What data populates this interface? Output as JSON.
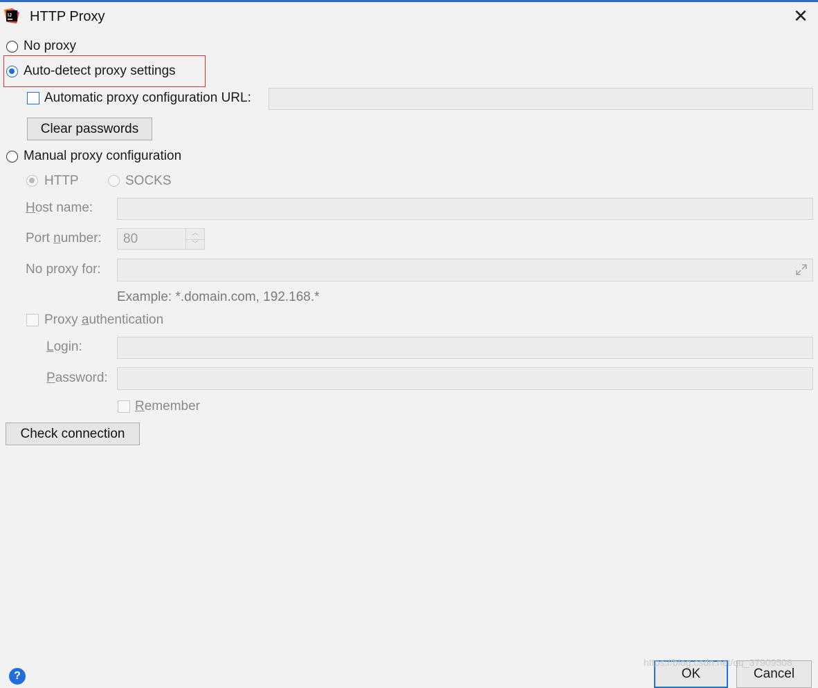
{
  "window": {
    "title": "HTTP Proxy",
    "app_icon": "intellij-idea-icon",
    "close_icon": "close-icon"
  },
  "modes": {
    "no_proxy": "No proxy",
    "auto_detect": "Auto-detect proxy settings",
    "manual": "Manual proxy configuration",
    "selected": "auto_detect"
  },
  "auto": {
    "pac_label": "Automatic proxy configuration URL:",
    "pac_checked": false,
    "pac_value": "",
    "clear_passwords": "Clear passwords"
  },
  "manual": {
    "http_label": "HTTP",
    "socks_label": "SOCKS",
    "protocol_selected": "HTTP",
    "host_label_first": "H",
    "host_label_rest": "ost name:",
    "host_value": "",
    "port_label_start": "Port ",
    "port_label_u": "n",
    "port_label_end": "umber:",
    "port_value": "80",
    "no_proxy_label": "No proxy for:",
    "no_proxy_value": "",
    "example": "Example: *.domain.com, 192.168.*",
    "auth_label_start": "Proxy ",
    "auth_label_u": "a",
    "auth_label_end": "uthentication",
    "login_label_u": "L",
    "login_label_rest": "ogin:",
    "login_value": "",
    "password_label_u": "P",
    "password_label_rest": "assword:",
    "password_value": "",
    "remember_u": "R",
    "remember_rest": "emember"
  },
  "buttons": {
    "check_connection": "Check connection",
    "ok": "OK",
    "cancel": "Cancel",
    "help": "?"
  },
  "watermark": "https://blog.csdn.net/qq_37909508",
  "colors": {
    "accent": "#1e6fd9",
    "highlight_box": "#e03131",
    "background": "#f2f2f2"
  }
}
